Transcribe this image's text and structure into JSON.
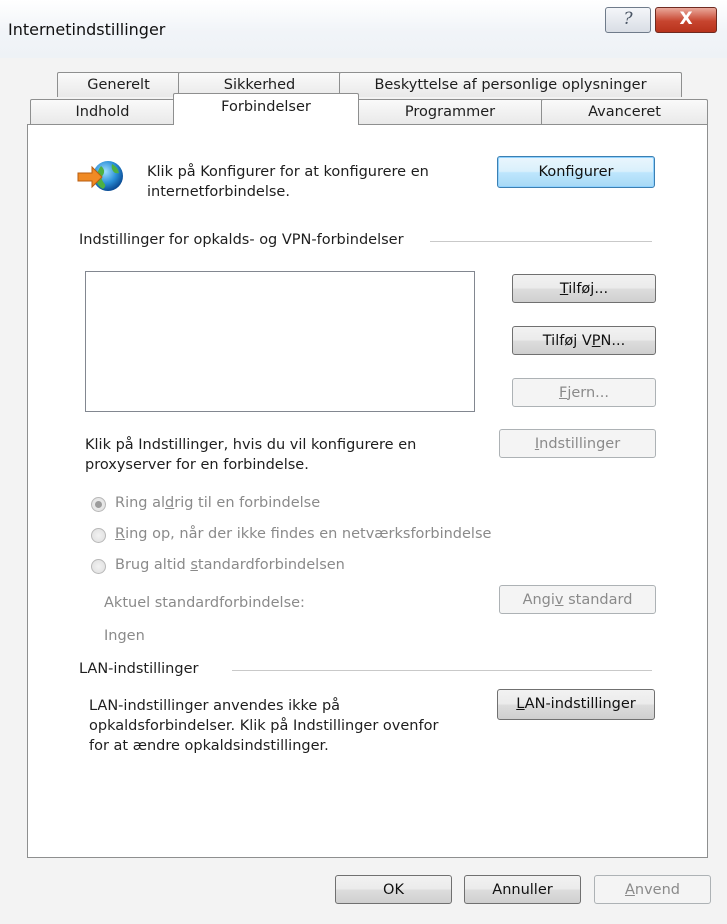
{
  "window": {
    "title": "Internetindstillinger",
    "help_glyph": "?",
    "close_glyph": "X"
  },
  "tabs_row1": [
    {
      "label": "Generelt"
    },
    {
      "label": "Sikkerhed"
    },
    {
      "label": "Beskyttelse af personlige oplysninger"
    }
  ],
  "tabs_row2": [
    {
      "label": "Indhold"
    },
    {
      "label": "Forbindelser",
      "active": true
    },
    {
      "label": "Programmer"
    },
    {
      "label": "Avanceret"
    }
  ],
  "setup": {
    "line1": "Klik på Konfigurer for at konfigurere en",
    "line2": "internetforbindelse.",
    "button": "Konfigurer",
    "icon": "globe-connection-icon"
  },
  "dialup": {
    "section_label": "Indstillinger for opkalds- og VPN-forbindelser",
    "connections": [],
    "add_button": {
      "pre": "",
      "ul": "T",
      "post": "ilføj..."
    },
    "add_vpn_button": {
      "pre": "Tilføj V",
      "ul": "P",
      "post": "N..."
    },
    "remove_button": {
      "pre": "",
      "ul": "F",
      "post": "jern..."
    },
    "settings_button": {
      "pre": "",
      "ul": "I",
      "post": "ndstillinger"
    },
    "proxy_line1": "Klik på Indstillinger, hvis du vil konfigurere en",
    "proxy_line2": "proxyserver for en forbindelse.",
    "radio_never": {
      "pre": "Ring al",
      "ul": "d",
      "post": "rig til en forbindelse",
      "selected": true
    },
    "radio_when_needed": {
      "pre": "",
      "ul": "R",
      "post": "ing op, når der ikke findes en netværksforbindelse",
      "selected": false
    },
    "radio_always": {
      "pre": "Brug altid ",
      "ul": "s",
      "post": "tandardforbindelsen",
      "selected": false
    },
    "current_default_label": "Aktuel standardforbindelse:",
    "current_default_value": "Ingen",
    "set_default_button": {
      "pre": "Angi",
      "ul": "v",
      "post": " standard"
    }
  },
  "lan": {
    "section_label": "LAN-indstillinger",
    "line1": "LAN-indstillinger anvendes ikke på",
    "line2": "opkaldsforbindelser. Klik på Indstillinger ovenfor",
    "line3": "for at ændre opkaldsindstillinger.",
    "button": {
      "pre": "",
      "ul": "L",
      "post": "AN-indstillinger"
    }
  },
  "footer": {
    "ok": "OK",
    "cancel": "Annuller",
    "apply": {
      "pre": "",
      "ul": "A",
      "post": "nvend"
    }
  }
}
